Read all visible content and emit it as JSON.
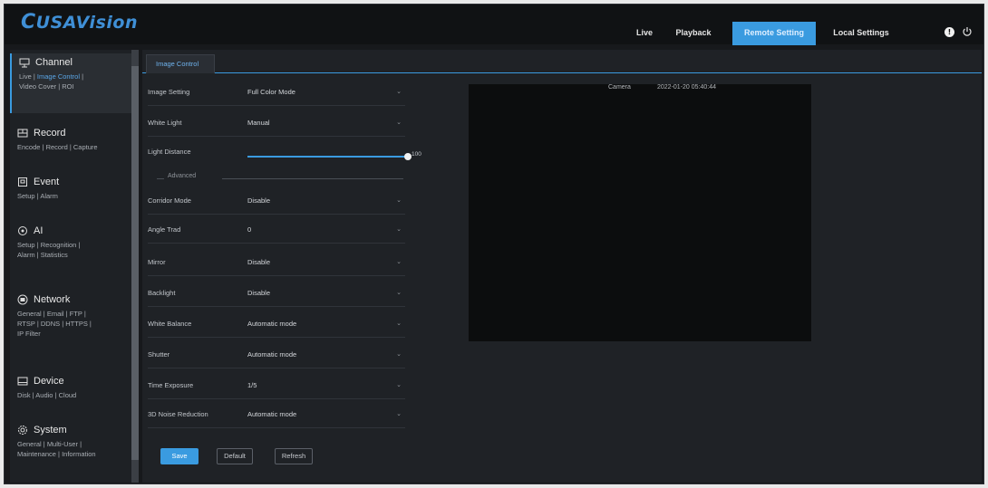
{
  "header": {
    "logo": "USAVision",
    "nav": [
      {
        "label": "Live",
        "active": false
      },
      {
        "label": "Playback",
        "active": false
      },
      {
        "label": "Remote Setting",
        "active": true
      },
      {
        "label": "Local Settings",
        "active": false
      }
    ],
    "icons": [
      "info-icon",
      "power-icon"
    ]
  },
  "sidebar": {
    "sections": [
      {
        "title": "Channel",
        "icon": "channel-icon",
        "links": [
          "Live",
          "Image Control",
          "Video Cover",
          "ROI"
        ],
        "active_link": "Image Control"
      },
      {
        "title": "Record",
        "icon": "record-icon",
        "links": [
          "Encode",
          "Record",
          "Capture"
        ]
      },
      {
        "title": "Event",
        "icon": "event-icon",
        "links": [
          "Setup",
          "Alarm"
        ]
      },
      {
        "title": "AI",
        "icon": "ai-icon",
        "links": [
          "Setup",
          "Recognition",
          "Alarm",
          "Statistics"
        ]
      },
      {
        "title": "Network",
        "icon": "network-icon",
        "links": [
          "General",
          "Email",
          "FTP",
          "RTSP",
          "DDNS",
          "HTTPS",
          "IP Filter"
        ]
      },
      {
        "title": "Device",
        "icon": "device-icon",
        "links": [
          "Disk",
          "Audio",
          "Cloud"
        ]
      },
      {
        "title": "System",
        "icon": "system-icon",
        "links": [
          "General",
          "Multi-User",
          "Maintenance",
          "Information"
        ]
      }
    ]
  },
  "main": {
    "tab": "Image Control",
    "fields": {
      "image_setting": {
        "label": "Image Setting",
        "value": "Full Color Mode"
      },
      "white_light": {
        "label": "White Light",
        "value": "Manual"
      },
      "light_distance": {
        "label": "Light Distance",
        "value": 100,
        "display": "100"
      },
      "advanced_label": "Advanced",
      "corridor_mode": {
        "label": "Corridor Mode",
        "value": "Disable"
      },
      "angle_trad": {
        "label": "Angle Trad",
        "value": "0"
      },
      "mirror": {
        "label": "Mirror",
        "value": "Disable"
      },
      "backlight": {
        "label": "Backlight",
        "value": "Disable"
      },
      "white_balance": {
        "label": "White Balance",
        "value": "Automatic mode"
      },
      "shutter": {
        "label": "Shutter",
        "value": "Automatic mode"
      },
      "time_exposure": {
        "label": "Time Exposure",
        "value": "1/5"
      },
      "noise_reduction": {
        "label": "3D Noise Reduction",
        "value": "Automatic mode"
      }
    },
    "buttons": {
      "save": "Save",
      "default": "Default",
      "refresh": "Refresh"
    },
    "camera": {
      "name": "Camera",
      "timestamp": "2022-01-20 05:40:44"
    }
  },
  "colors": {
    "accent": "#3a9be0",
    "background": "#1f2226",
    "header": "#101214"
  }
}
